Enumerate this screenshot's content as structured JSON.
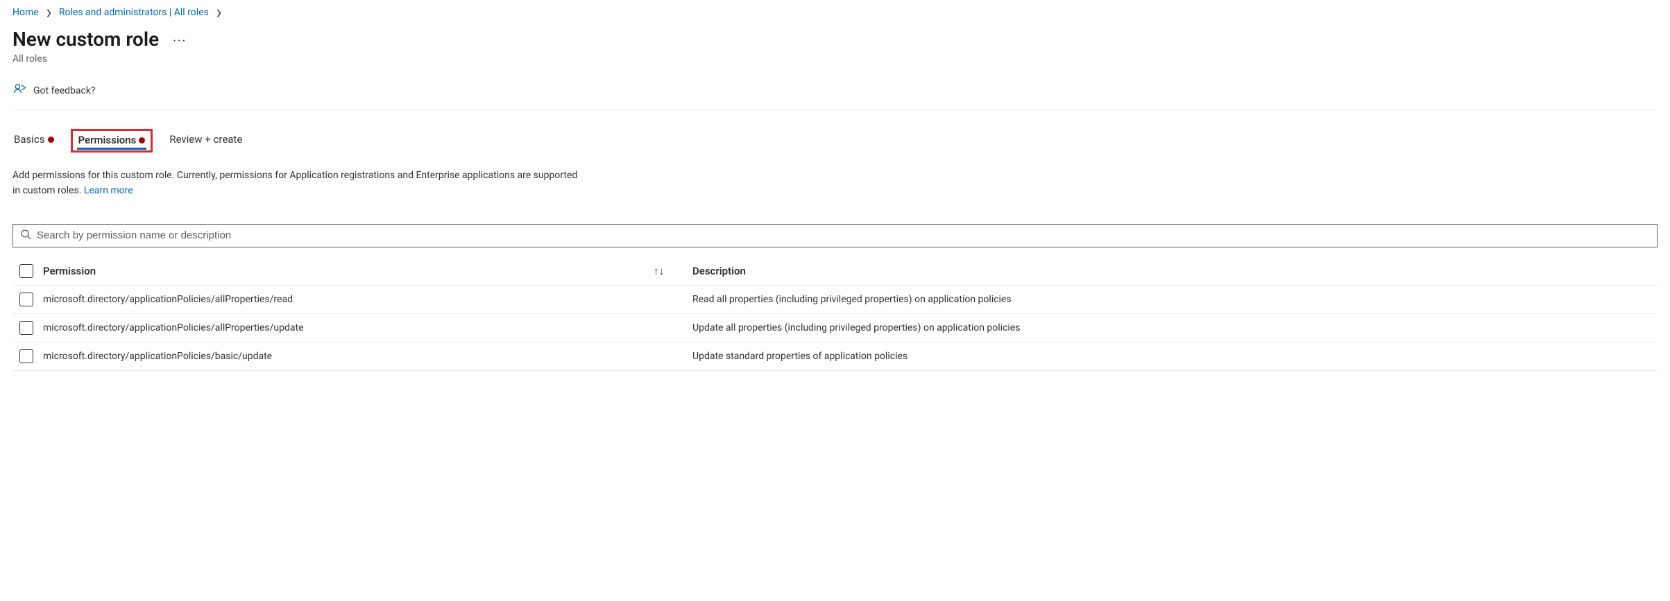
{
  "breadcrumb": {
    "home": "Home",
    "roles": "Roles and administrators | All roles"
  },
  "page": {
    "title": "New custom role",
    "subtitle": "All roles"
  },
  "feedback": {
    "label": "Got feedback?"
  },
  "tabs": {
    "basics": "Basics",
    "permissions": "Permissions",
    "review": "Review + create"
  },
  "intro": {
    "line1": "Add permissions for this custom role. Currently, permissions for Application registrations and Enterprise applications are supported",
    "line2_prefix": "in custom roles. ",
    "learn_more": "Learn more"
  },
  "search": {
    "placeholder": "Search by permission name or description"
  },
  "table": {
    "headers": {
      "permission": "Permission",
      "description": "Description"
    },
    "rows": [
      {
        "permission": "microsoft.directory/applicationPolicies/allProperties/read",
        "description": "Read all properties (including privileged properties) on application policies"
      },
      {
        "permission": "microsoft.directory/applicationPolicies/allProperties/update",
        "description": "Update all properties (including privileged properties) on application policies"
      },
      {
        "permission": "microsoft.directory/applicationPolicies/basic/update",
        "description": "Update standard properties of application policies"
      }
    ]
  }
}
